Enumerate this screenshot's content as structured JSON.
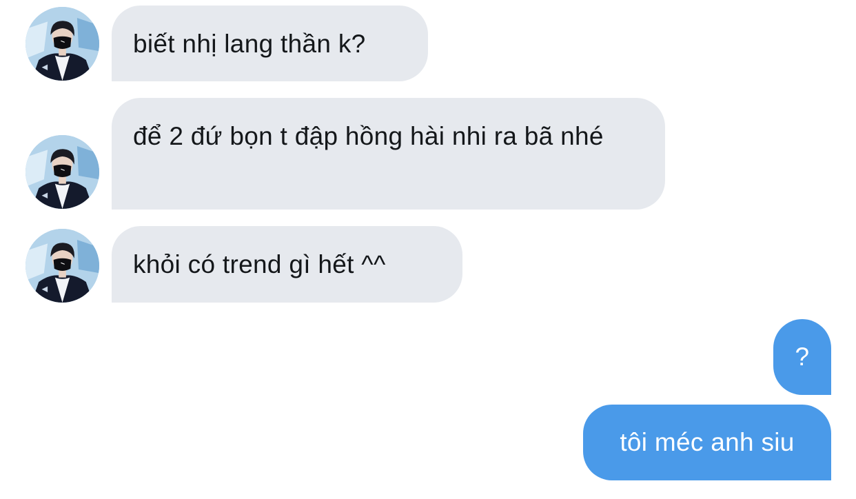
{
  "conversation": {
    "incoming": [
      {
        "text": "biết nhị lang thần k?"
      },
      {
        "text": "để 2 đứ bọn t đập hồng hài nhi ra bã nhé"
      },
      {
        "text": "khỏi có trend gì hết ^^"
      }
    ],
    "outgoing": [
      {
        "text": "?"
      },
      {
        "text": "tôi méc anh siu"
      }
    ]
  },
  "colors": {
    "incoming_bubble": "#e6e9ee",
    "incoming_text": "#14171a",
    "outgoing_bubble": "#4a9ae9",
    "outgoing_text": "#ffffff",
    "background": "#ffffff"
  },
  "icons": {
    "contact_avatar": "contact-avatar-photo"
  }
}
